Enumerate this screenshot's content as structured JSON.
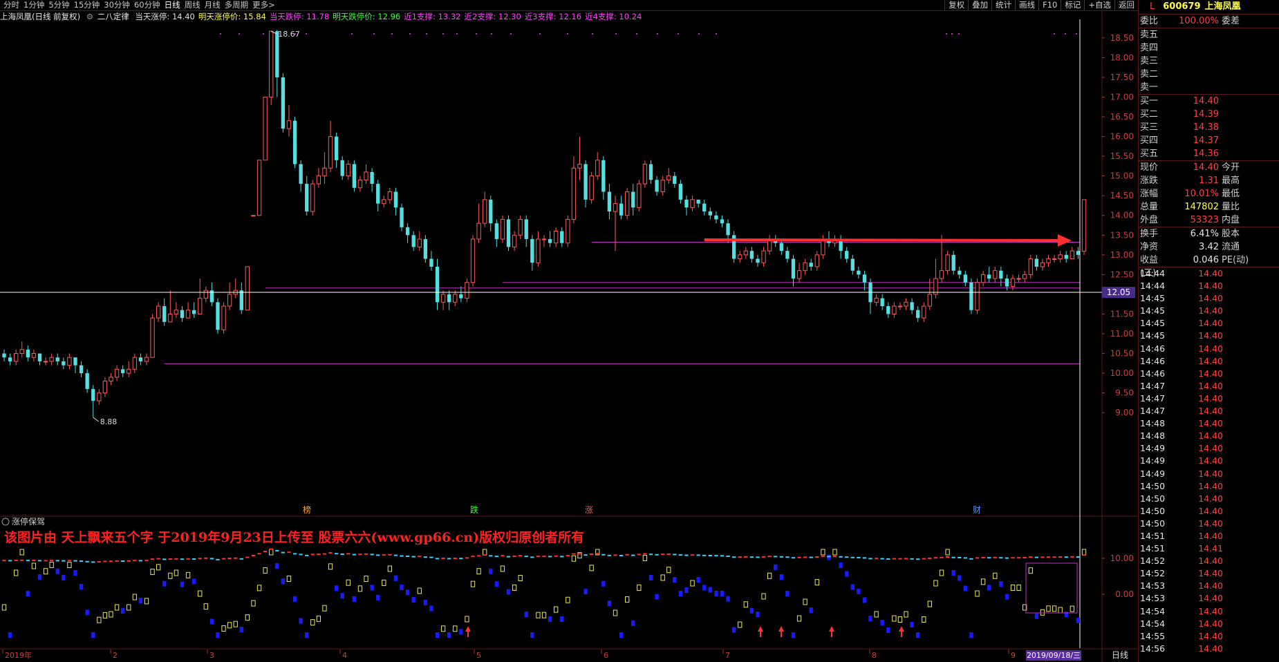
{
  "toolbar": {
    "periods": [
      "分时",
      "1分钟",
      "5分钟",
      "15分钟",
      "30分钟",
      "60分钟",
      "日线",
      "周线",
      "月线",
      "多周期",
      "更多>"
    ],
    "active_period": "日线",
    "right_buttons": [
      "复权",
      "叠加",
      "统计",
      "画线",
      "F10",
      "标记",
      "+自选",
      "返回"
    ]
  },
  "info_line": {
    "title": "上海凤凰(日线 前复权)",
    "indicator": "二八定律",
    "items": [
      {
        "text": "当天涨停: 14.40",
        "color": "#e0e0e0"
      },
      {
        "text": "明天涨停价: 15.84",
        "color": "#ffff4a"
      },
      {
        "text": "当天跌停: 11.78",
        "color": "#ff40ff"
      },
      {
        "text": "明天跌停价: 12.96",
        "color": "#40ff40"
      },
      {
        "text": "近1支撑: 13.32",
        "color": "#ff40ff"
      },
      {
        "text": "近2支撑: 12.30",
        "color": "#ff40ff"
      },
      {
        "text": "近3支撑: 12.16",
        "color": "#ff40ff"
      },
      {
        "text": "近4支撑: 10.24",
        "color": "#ff40ff"
      }
    ]
  },
  "price_chart": {
    "y_ticks": [
      "18.50",
      "18.00",
      "17.50",
      "17.00",
      "16.50",
      "16.00",
      "15.50",
      "15.00",
      "14.50",
      "14.00",
      "13.50",
      "13.00",
      "12.50",
      "12.00",
      "11.50",
      "11.00",
      "10.50",
      "10.00",
      "9.50",
      "9.00"
    ],
    "high_label": "18.67",
    "low_label": "8.88",
    "crosshair_price": "12.05",
    "event_marks": [
      {
        "text": "榜",
        "color": "#ffaa33"
      },
      {
        "text": "跌",
        "color": "#40ff40"
      },
      {
        "text": "涨",
        "color": "#ff5050"
      },
      {
        "text": "财",
        "color": "#6090ff"
      }
    ]
  },
  "lower_panel": {
    "title": "涨停保驾",
    "watermark": "该图片由 天上飘来五个字 于2019年9月23日上传至 股票六六(www.gp66.cn)版权归原创者所有",
    "y_ticks": [
      "10.00",
      "0.00"
    ]
  },
  "time_axis": {
    "labels": [
      "2019年",
      "2",
      "3",
      "4",
      "5",
      "6",
      "7",
      "8",
      "9"
    ],
    "current_date": "2019/09/18/三",
    "period_label": "日线"
  },
  "quote_panel": {
    "marker": "L",
    "code": "600679",
    "name": "上海凤凰",
    "weibi_label": "委比",
    "weibi_value": "100.00%",
    "weicha_label": "委差",
    "sell": [
      {
        "label": "卖五"
      },
      {
        "label": "卖四"
      },
      {
        "label": "卖三"
      },
      {
        "label": "卖二"
      },
      {
        "label": "卖一"
      }
    ],
    "buy": [
      {
        "label": "买一",
        "price": "14.40"
      },
      {
        "label": "买二",
        "price": "14.39"
      },
      {
        "label": "买三",
        "price": "14.38"
      },
      {
        "label": "买四",
        "price": "14.37"
      },
      {
        "label": "买五",
        "price": "14.36"
      }
    ],
    "stats": [
      {
        "l1": "现价",
        "v1": "14.40",
        "c1": "#ff4040",
        "l2": "今开"
      },
      {
        "l1": "涨跌",
        "v1": "1.31",
        "c1": "#ff4040",
        "l2": "最高"
      },
      {
        "l1": "涨幅",
        "v1": "10.01%",
        "c1": "#ff4040",
        "l2": "最低"
      },
      {
        "l1": "总量",
        "v1": "147802",
        "c1": "#ffff4a",
        "l2": "量比"
      },
      {
        "l1": "外盘",
        "v1": "53323",
        "c1": "#ff4040",
        "l2": "内盘"
      }
    ],
    "stats2": [
      {
        "l1": "换手",
        "v1": "6.41%",
        "c1": "#e8e8e8",
        "l2": "股本"
      },
      {
        "l1": "净资",
        "v1": "3.42",
        "c1": "#e8e8e8",
        "l2": "流通"
      },
      {
        "l1": "收益(三)",
        "v1": "0.046",
        "c1": "#e8e8e8",
        "l2": "PE(动)"
      }
    ],
    "ticks": [
      {
        "t": "14:44",
        "p": "14.40"
      },
      {
        "t": "14:44",
        "p": "14.40"
      },
      {
        "t": "14:45",
        "p": "14.40"
      },
      {
        "t": "14:45",
        "p": "14.40"
      },
      {
        "t": "14:45",
        "p": "14.40"
      },
      {
        "t": "14:45",
        "p": "14.40"
      },
      {
        "t": "14:46",
        "p": "14.40"
      },
      {
        "t": "14:46",
        "p": "14.40"
      },
      {
        "t": "14:46",
        "p": "14.40"
      },
      {
        "t": "14:47",
        "p": "14.40"
      },
      {
        "t": "14:47",
        "p": "14.40"
      },
      {
        "t": "14:47",
        "p": "14.40"
      },
      {
        "t": "14:48",
        "p": "14.40"
      },
      {
        "t": "14:48",
        "p": "14.40"
      },
      {
        "t": "14:49",
        "p": "14.40"
      },
      {
        "t": "14:49",
        "p": "14.40"
      },
      {
        "t": "14:49",
        "p": "14.40"
      },
      {
        "t": "14:50",
        "p": "14.40"
      },
      {
        "t": "14:50",
        "p": "14.40"
      },
      {
        "t": "14:50",
        "p": "14.40"
      },
      {
        "t": "14:50",
        "p": "14.40"
      },
      {
        "t": "14:51",
        "p": "14.40"
      },
      {
        "t": "14:51",
        "p": "14.41"
      },
      {
        "t": "14:52",
        "p": "14.40"
      },
      {
        "t": "14:52",
        "p": "14.40"
      },
      {
        "t": "14:53",
        "p": "14.40"
      },
      {
        "t": "14:53",
        "p": "14.40"
      },
      {
        "t": "14:54",
        "p": "14.40"
      },
      {
        "t": "14:54",
        "p": "14.40"
      },
      {
        "t": "14:55",
        "p": "14.40"
      },
      {
        "t": "14:56",
        "p": "14.40"
      }
    ]
  },
  "chart_data": {
    "type": "candlestick",
    "ylim": [
      8.6,
      18.9
    ],
    "candles": [
      [
        10.5,
        10.4,
        10.6,
        10.3
      ],
      [
        10.4,
        10.3,
        10.5,
        10.2
      ],
      [
        10.3,
        10.5,
        10.6,
        10.2
      ],
      [
        10.5,
        10.6,
        10.8,
        10.4
      ],
      [
        10.6,
        10.4,
        10.7,
        10.3
      ],
      [
        10.4,
        10.5,
        10.6,
        10.3
      ],
      [
        10.5,
        10.3,
        10.5,
        10.2
      ],
      [
        10.3,
        10.3,
        10.4,
        10.2
      ],
      [
        10.3,
        10.4,
        10.5,
        10.2
      ],
      [
        10.4,
        10.3,
        10.5,
        10.2
      ],
      [
        10.3,
        10.2,
        10.4,
        10.1
      ],
      [
        10.2,
        10.4,
        10.5,
        10.1
      ],
      [
        10.4,
        10.2,
        10.4,
        10.0
      ],
      [
        10.2,
        10.0,
        10.3,
        9.9
      ],
      [
        10.0,
        9.6,
        10.1,
        9.5
      ],
      [
        9.6,
        9.3,
        9.7,
        8.88
      ],
      [
        9.3,
        9.5,
        9.6,
        9.2
      ],
      [
        9.5,
        9.8,
        9.9,
        9.4
      ],
      [
        9.8,
        9.9,
        10.0,
        9.7
      ],
      [
        9.9,
        10.1,
        10.2,
        9.8
      ],
      [
        10.1,
        10.0,
        10.2,
        9.9
      ],
      [
        10.0,
        10.1,
        10.3,
        9.9
      ],
      [
        10.1,
        10.4,
        10.5,
        10.0
      ],
      [
        10.4,
        10.3,
        10.5,
        10.2
      ],
      [
        10.3,
        10.4,
        10.5,
        10.2
      ],
      [
        10.4,
        11.4,
        11.5,
        10.4
      ],
      [
        11.4,
        11.7,
        11.8,
        11.3
      ],
      [
        11.7,
        11.3,
        11.9,
        11.2
      ],
      [
        11.3,
        11.5,
        12.1,
        11.3
      ],
      [
        11.5,
        11.6,
        11.8,
        11.4
      ],
      [
        11.6,
        11.4,
        11.7,
        11.3
      ],
      [
        11.4,
        11.6,
        11.8,
        11.4
      ],
      [
        11.6,
        11.5,
        11.8,
        11.4
      ],
      [
        11.5,
        11.9,
        12.4,
        11.5
      ],
      [
        11.9,
        12.1,
        12.2,
        11.8
      ],
      [
        12.1,
        11.8,
        12.3,
        11.7
      ],
      [
        11.8,
        11.1,
        11.9,
        11.0
      ],
      [
        11.1,
        11.7,
        11.8,
        11.0
      ],
      [
        11.7,
        12.0,
        12.3,
        11.6
      ],
      [
        12.0,
        12.1,
        12.4,
        11.9
      ],
      [
        12.1,
        11.6,
        12.3,
        11.5
      ],
      [
        11.6,
        12.7,
        12.7,
        11.6
      ],
      [
        14.0,
        14.0,
        14.0,
        14.0
      ],
      [
        14.0,
        15.4,
        15.4,
        14.0
      ],
      [
        15.4,
        17.0,
        17.0,
        15.4
      ],
      [
        17.0,
        18.67,
        18.67,
        16.8
      ],
      [
        18.67,
        17.5,
        18.7,
        17.0
      ],
      [
        17.5,
        16.2,
        17.6,
        16.1
      ],
      [
        16.2,
        16.4,
        16.8,
        16.0
      ],
      [
        16.4,
        15.3,
        16.5,
        15.2
      ],
      [
        15.3,
        14.8,
        15.4,
        14.6
      ],
      [
        14.8,
        14.1,
        15.0,
        14.0
      ],
      [
        14.1,
        14.8,
        14.9,
        14.0
      ],
      [
        14.8,
        15.0,
        15.2,
        14.7
      ],
      [
        15.0,
        15.2,
        15.6,
        14.8
      ],
      [
        15.2,
        16.0,
        16.4,
        15.1
      ],
      [
        16.0,
        15.4,
        16.1,
        15.2
      ],
      [
        15.4,
        15.0,
        15.5,
        14.9
      ],
      [
        15.0,
        15.3,
        15.4,
        14.9
      ],
      [
        15.3,
        14.7,
        15.4,
        14.6
      ],
      [
        14.7,
        14.9,
        15.0,
        14.6
      ],
      [
        14.9,
        15.1,
        15.3,
        14.8
      ],
      [
        15.1,
        14.8,
        15.2,
        14.6
      ],
      [
        14.8,
        14.3,
        14.9,
        14.1
      ],
      [
        14.3,
        14.4,
        14.5,
        14.2
      ],
      [
        14.4,
        14.6,
        14.7,
        14.3
      ],
      [
        14.6,
        14.2,
        14.7,
        14.0
      ],
      [
        14.2,
        13.7,
        14.3,
        13.6
      ],
      [
        13.7,
        13.5,
        13.8,
        13.3
      ],
      [
        13.5,
        13.2,
        13.6,
        13.1
      ],
      [
        13.2,
        13.4,
        13.6,
        13.1
      ],
      [
        13.4,
        12.9,
        13.5,
        12.8
      ],
      [
        12.9,
        12.7,
        13.1,
        12.6
      ],
      [
        12.7,
        11.8,
        12.9,
        11.6
      ],
      [
        11.8,
        12.0,
        12.1,
        11.6
      ],
      [
        12.0,
        11.8,
        12.1,
        11.6
      ],
      [
        11.8,
        12.0,
        12.1,
        11.7
      ],
      [
        12.0,
        11.9,
        12.2,
        11.8
      ],
      [
        11.9,
        12.3,
        12.4,
        11.8
      ],
      [
        12.3,
        13.4,
        13.5,
        12.2
      ],
      [
        13.4,
        13.8,
        14.3,
        13.3
      ],
      [
        13.8,
        14.4,
        14.6,
        13.7
      ],
      [
        14.4,
        13.8,
        14.5,
        13.6
      ],
      [
        13.8,
        13.4,
        13.9,
        13.2
      ],
      [
        13.4,
        13.9,
        14.0,
        13.3
      ],
      [
        13.9,
        13.2,
        14.0,
        13.1
      ],
      [
        13.2,
        13.5,
        13.6,
        13.1
      ],
      [
        13.5,
        13.9,
        14.0,
        13.4
      ],
      [
        13.9,
        13.4,
        14.0,
        13.2
      ],
      [
        13.4,
        12.8,
        13.5,
        12.6
      ],
      [
        12.8,
        13.4,
        13.6,
        12.7
      ],
      [
        13.4,
        13.4,
        13.5,
        13.2
      ],
      [
        13.4,
        13.3,
        13.6,
        13.2
      ],
      [
        13.3,
        13.6,
        13.7,
        13.2
      ],
      [
        13.6,
        13.3,
        13.7,
        13.2
      ],
      [
        13.3,
        13.9,
        14.0,
        13.2
      ],
      [
        13.9,
        15.2,
        15.5,
        13.8
      ],
      [
        15.2,
        15.3,
        16.0,
        14.9
      ],
      [
        15.3,
        14.4,
        15.4,
        14.2
      ],
      [
        14.4,
        15.0,
        15.1,
        14.3
      ],
      [
        15.0,
        15.4,
        15.6,
        14.9
      ],
      [
        15.4,
        14.6,
        15.5,
        14.4
      ],
      [
        14.6,
        14.1,
        14.8,
        13.9
      ],
      [
        14.1,
        14.3,
        14.5,
        13.1
      ],
      [
        14.3,
        14.0,
        14.5,
        13.9
      ],
      [
        14.0,
        14.6,
        14.7,
        13.9
      ],
      [
        14.6,
        14.2,
        14.8,
        14.0
      ],
      [
        14.2,
        14.8,
        14.9,
        14.1
      ],
      [
        14.8,
        15.3,
        15.4,
        14.7
      ],
      [
        15.3,
        14.9,
        15.4,
        14.8
      ],
      [
        14.9,
        14.6,
        15.0,
        14.5
      ],
      [
        14.6,
        14.9,
        15.0,
        14.5
      ],
      [
        14.9,
        15.0,
        15.2,
        14.8
      ],
      [
        15.0,
        14.8,
        15.1,
        14.7
      ],
      [
        14.8,
        14.4,
        14.9,
        14.3
      ],
      [
        14.4,
        14.2,
        14.5,
        14.0
      ],
      [
        14.2,
        14.4,
        14.5,
        14.1
      ],
      [
        14.4,
        14.3,
        14.4,
        14.2
      ],
      [
        14.3,
        14.1,
        14.4,
        14.0
      ],
      [
        14.1,
        14.0,
        14.2,
        13.9
      ],
      [
        14.0,
        13.9,
        14.1,
        13.8
      ],
      [
        13.9,
        13.8,
        14.0,
        13.7
      ],
      [
        13.8,
        13.5,
        13.9,
        13.3
      ],
      [
        13.5,
        12.9,
        13.6,
        12.8
      ],
      [
        12.9,
        13.0,
        13.1,
        12.8
      ],
      [
        13.0,
        13.1,
        13.2,
        12.9
      ],
      [
        13.1,
        12.9,
        13.2,
        12.8
      ],
      [
        12.9,
        12.8,
        13.0,
        12.7
      ],
      [
        12.8,
        13.1,
        13.2,
        12.7
      ],
      [
        13.1,
        13.4,
        13.5,
        13.0
      ],
      [
        13.4,
        13.3,
        13.5,
        13.2
      ],
      [
        13.3,
        13.1,
        13.4,
        13.0
      ],
      [
        13.1,
        12.9,
        13.2,
        12.8
      ],
      [
        12.9,
        12.4,
        13.0,
        12.2
      ],
      [
        12.4,
        12.6,
        12.8,
        12.3
      ],
      [
        12.6,
        12.8,
        12.9,
        12.5
      ],
      [
        12.8,
        12.7,
        12.9,
        12.6
      ],
      [
        12.7,
        13.0,
        13.1,
        12.6
      ],
      [
        13.0,
        13.4,
        13.5,
        12.9
      ],
      [
        13.4,
        13.3,
        13.6,
        13.2
      ],
      [
        13.3,
        13.4,
        13.5,
        13.2
      ],
      [
        13.4,
        13.1,
        13.5,
        12.9
      ],
      [
        13.1,
        12.9,
        13.2,
        12.8
      ],
      [
        12.9,
        12.6,
        13.0,
        12.5
      ],
      [
        12.6,
        12.5,
        12.7,
        12.4
      ],
      [
        12.5,
        12.3,
        12.6,
        12.1
      ],
      [
        12.3,
        11.8,
        12.4,
        11.5
      ],
      [
        11.8,
        11.9,
        12.0,
        11.7
      ],
      [
        11.9,
        11.7,
        12.0,
        11.6
      ],
      [
        11.7,
        11.5,
        11.8,
        11.4
      ],
      [
        11.5,
        11.7,
        11.8,
        11.4
      ],
      [
        11.7,
        11.7,
        11.8,
        11.6
      ],
      [
        11.7,
        11.8,
        11.9,
        11.6
      ],
      [
        11.8,
        11.6,
        11.9,
        11.5
      ],
      [
        11.6,
        11.4,
        11.7,
        11.3
      ],
      [
        11.4,
        11.7,
        11.8,
        11.3
      ],
      [
        11.7,
        12.0,
        12.4,
        11.6
      ],
      [
        12.0,
        12.4,
        12.9,
        11.9
      ],
      [
        12.4,
        12.6,
        13.5,
        12.3
      ],
      [
        12.6,
        13.0,
        13.1,
        12.5
      ],
      [
        13.0,
        12.6,
        13.1,
        12.5
      ],
      [
        12.6,
        12.5,
        12.7,
        12.4
      ],
      [
        12.5,
        12.3,
        12.6,
        12.2
      ],
      [
        12.3,
        11.6,
        12.4,
        11.5
      ],
      [
        11.6,
        12.3,
        12.4,
        11.5
      ],
      [
        12.3,
        12.5,
        12.6,
        12.2
      ],
      [
        12.5,
        12.4,
        12.7,
        12.3
      ],
      [
        12.4,
        12.6,
        12.7,
        12.3
      ],
      [
        12.6,
        12.4,
        12.7,
        12.2
      ],
      [
        12.4,
        12.2,
        12.5,
        12.1
      ],
      [
        12.2,
        12.4,
        12.5,
        12.1
      ],
      [
        12.4,
        12.4,
        12.5,
        12.3
      ],
      [
        12.4,
        12.5,
        12.6,
        12.3
      ],
      [
        12.5,
        12.9,
        13.0,
        12.4
      ],
      [
        12.9,
        12.7,
        13.0,
        12.6
      ],
      [
        12.7,
        12.8,
        12.9,
        12.6
      ],
      [
        12.8,
        12.9,
        13.0,
        12.7
      ],
      [
        12.9,
        12.9,
        13.0,
        12.8
      ],
      [
        12.9,
        13.0,
        13.1,
        12.8
      ],
      [
        13.0,
        12.9,
        13.1,
        12.8
      ],
      [
        12.9,
        13.1,
        13.2,
        12.9
      ],
      [
        13.1,
        13.0,
        13.2,
        12.9
      ],
      [
        13.09,
        14.4,
        14.4,
        13.0
      ]
    ],
    "support_lines": [
      {
        "value": 13.32,
        "from_index": 99
      },
      {
        "value": 12.3,
        "from_index": 84
      },
      {
        "value": 12.16,
        "from_index": 44
      },
      {
        "value": 10.24,
        "from_index": 27
      }
    ]
  }
}
